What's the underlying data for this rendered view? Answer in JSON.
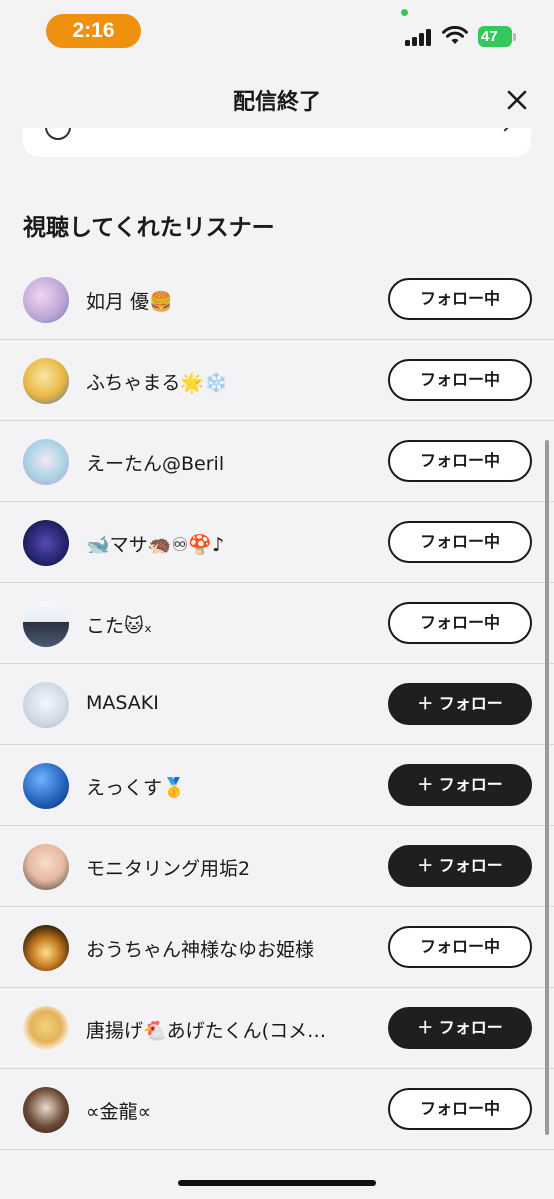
{
  "status_bar": {
    "time": "2:16",
    "battery": "47",
    "icons": [
      "signal-icon",
      "wifi-icon",
      "battery-icon"
    ]
  },
  "header": {
    "title": "配信終了",
    "close_icon": "close-icon"
  },
  "section": {
    "title": "視聴してくれたリスナー"
  },
  "listeners": [
    {
      "name": "如月 優🍔",
      "button": "フォロー中",
      "state": "following",
      "avatar_color": "#b9a4d6"
    },
    {
      "name": "ふちゃまる🌟❄️",
      "button": "フォロー中",
      "state": "following",
      "avatar_color": "#e8b640"
    },
    {
      "name": "えーたん@Beril",
      "button": "フォロー中",
      "state": "following",
      "avatar_color": "#a7d4e6"
    },
    {
      "name": "🐋マサ🦔♾🍄♪",
      "button": "フォロー中",
      "state": "following",
      "avatar_color": "#2a2a7a"
    },
    {
      "name": "こた🐱ₓ",
      "button": "フォロー中",
      "state": "following",
      "avatar_color": "#e9eef5"
    },
    {
      "name": "MASAKI",
      "button": "＋ フォロー",
      "state": "follow",
      "avatar_color": "#cfd9e6"
    },
    {
      "name": "えっくす🥇",
      "button": "＋ フォロー",
      "state": "follow",
      "avatar_color": "#1f5fb8"
    },
    {
      "name": "モニタリング用垢2",
      "button": "＋ フォロー",
      "state": "follow",
      "avatar_color": "#e6b9a0"
    },
    {
      "name": "おうちゃん神様なゆお姫様",
      "button": "フォロー中",
      "state": "following",
      "avatar_color": "#c47a20"
    },
    {
      "name": "唐揚げ🐔あげたくん(コメ…",
      "button": "＋ フォロー",
      "state": "follow",
      "avatar_color": "#f2d27a"
    },
    {
      "name": "∝金龍∝",
      "button": "フォロー中",
      "state": "following",
      "avatar_color": "#6b4a35"
    }
  ]
}
